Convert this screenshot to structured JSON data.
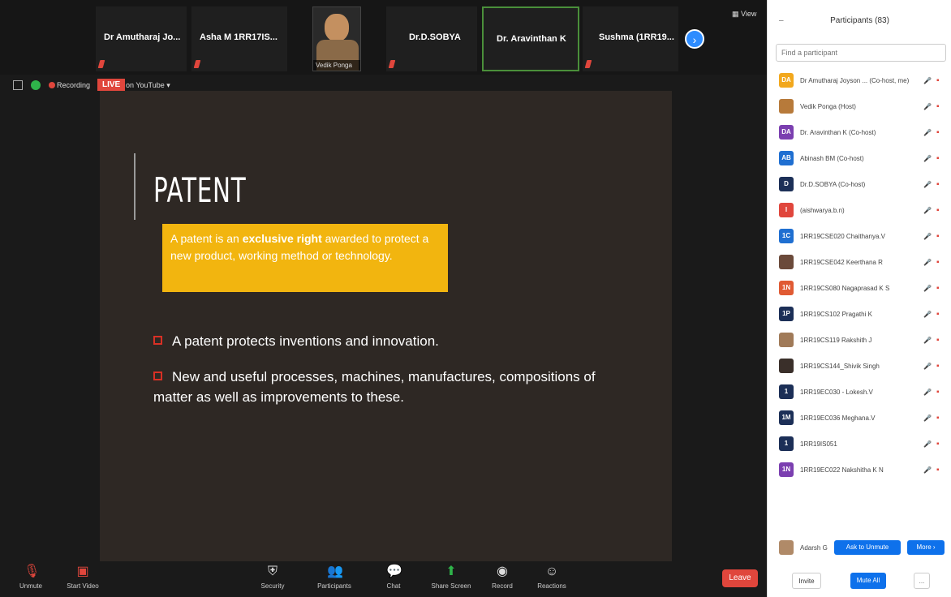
{
  "strip": {
    "tiles": [
      {
        "name": "Dr Amutharaj Jo..."
      },
      {
        "name": "Asha M 1RR17IS..."
      },
      {
        "name": "Dr.D.SOBYA"
      },
      {
        "name": "Dr. Aravinthan K"
      },
      {
        "name": "Sushma (1RR19..."
      }
    ],
    "video_name": "Vedik Ponga",
    "view_label": "View"
  },
  "status": {
    "recording": "Recording",
    "live": "LIVE",
    "youtube": "on YouTube"
  },
  "slide": {
    "title": "PATENT",
    "box_pre": "A patent is an ",
    "box_bold": "exclusive right",
    "box_post": " awarded to protect a new product, working method or technology.",
    "bullet1": "A patent protects inventions and innovation.",
    "bullet2_line1": "New and useful processes, machines, manufactures, compositions of",
    "bullet2_line2": "matter as well as improvements to these."
  },
  "toolbar": {
    "unmute": "Unmute",
    "start_video": "Start Video",
    "security": "Security",
    "participants": "Participants",
    "participants_count": "83",
    "chat": "Chat",
    "share_screen": "Share Screen",
    "record": "Record",
    "reactions": "Reactions",
    "leave": "Leave"
  },
  "panel": {
    "title": "Participants (83)",
    "search_placeholder": "Find a participant",
    "participants": [
      {
        "initials": "DA",
        "color": "#f2a81d",
        "name": "Dr Amutharaj Joyson ... (Co-host, me)"
      },
      {
        "initials": "",
        "color": "#b77a3a",
        "name": "Vedik Ponga (Host)"
      },
      {
        "initials": "DA",
        "color": "#7b3fb0",
        "name": "Dr. Aravinthan K (Co-host)"
      },
      {
        "initials": "AB",
        "color": "#1f6fd1",
        "name": "Abinash BM (Co-host)"
      },
      {
        "initials": "D",
        "color": "#1c2f57",
        "name": "Dr.D.SOBYA (Co-host)"
      },
      {
        "initials": "I",
        "color": "#e0463c",
        "name": "(aishwarya.b.n)"
      },
      {
        "initials": "1C",
        "color": "#1f6fd1",
        "name": "1RR19CSE020 Chaithanya.V"
      },
      {
        "initials": "",
        "color": "#6b4a3a",
        "name": "1RR19CSE042 Keerthana R"
      },
      {
        "initials": "1N",
        "color": "#e05a33",
        "name": "1RR19CS080 Nagaprasad K S"
      },
      {
        "initials": "1P",
        "color": "#1c2f57",
        "name": "1RR19CS102 Pragathi K"
      },
      {
        "initials": "",
        "color": "#a07a58",
        "name": "1RR19CS119 Rakshith J"
      },
      {
        "initials": "",
        "color": "#3a2f2a",
        "name": "1RR19CS144_Shivik Singh"
      },
      {
        "initials": "1",
        "color": "#1c2f57",
        "name": "1RR19EC030 - Lokesh.V"
      },
      {
        "initials": "1M",
        "color": "#1c2f57",
        "name": "1RR19EC036 Meghana.V"
      },
      {
        "initials": "1",
        "color": "#1c2f57",
        "name": "1RR19IS051"
      },
      {
        "initials": "1N",
        "color": "#7b3fb0",
        "name": "1RR19EC022 Nakshitha K N"
      }
    ],
    "last_row_name": "Adarsh G",
    "ask_unmute": "Ask to Unmute",
    "more": "More ›",
    "invite": "Invite",
    "mute_all": "Mute All",
    "more_dots": "..."
  }
}
